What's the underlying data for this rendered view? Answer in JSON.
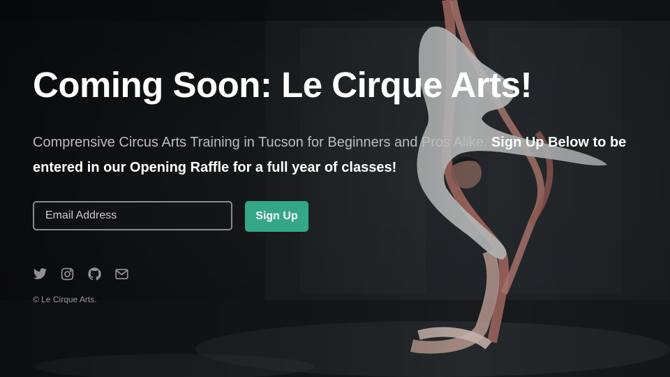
{
  "hero": {
    "headline": "Coming Soon: Le Cirque Arts!",
    "lead_text": "Comprensive Circus Arts Training in Tucson for Beginners and Pros Alike. ",
    "lead_emphasis": "Sign Up Below to be entered in our Opening Raffle for a full year of classes!"
  },
  "signup": {
    "email_placeholder": "Email Address",
    "email_value": "",
    "button_label": "Sign Up",
    "button_color": "#35a789"
  },
  "social_links": [
    {
      "icon": "twitter-icon"
    },
    {
      "icon": "instagram-icon"
    },
    {
      "icon": "github-icon"
    },
    {
      "icon": "envelope-icon"
    }
  ],
  "footer": {
    "copyright": "© Le Cirque Arts."
  },
  "background": {
    "image": "aerial-silks-performer-photo"
  }
}
